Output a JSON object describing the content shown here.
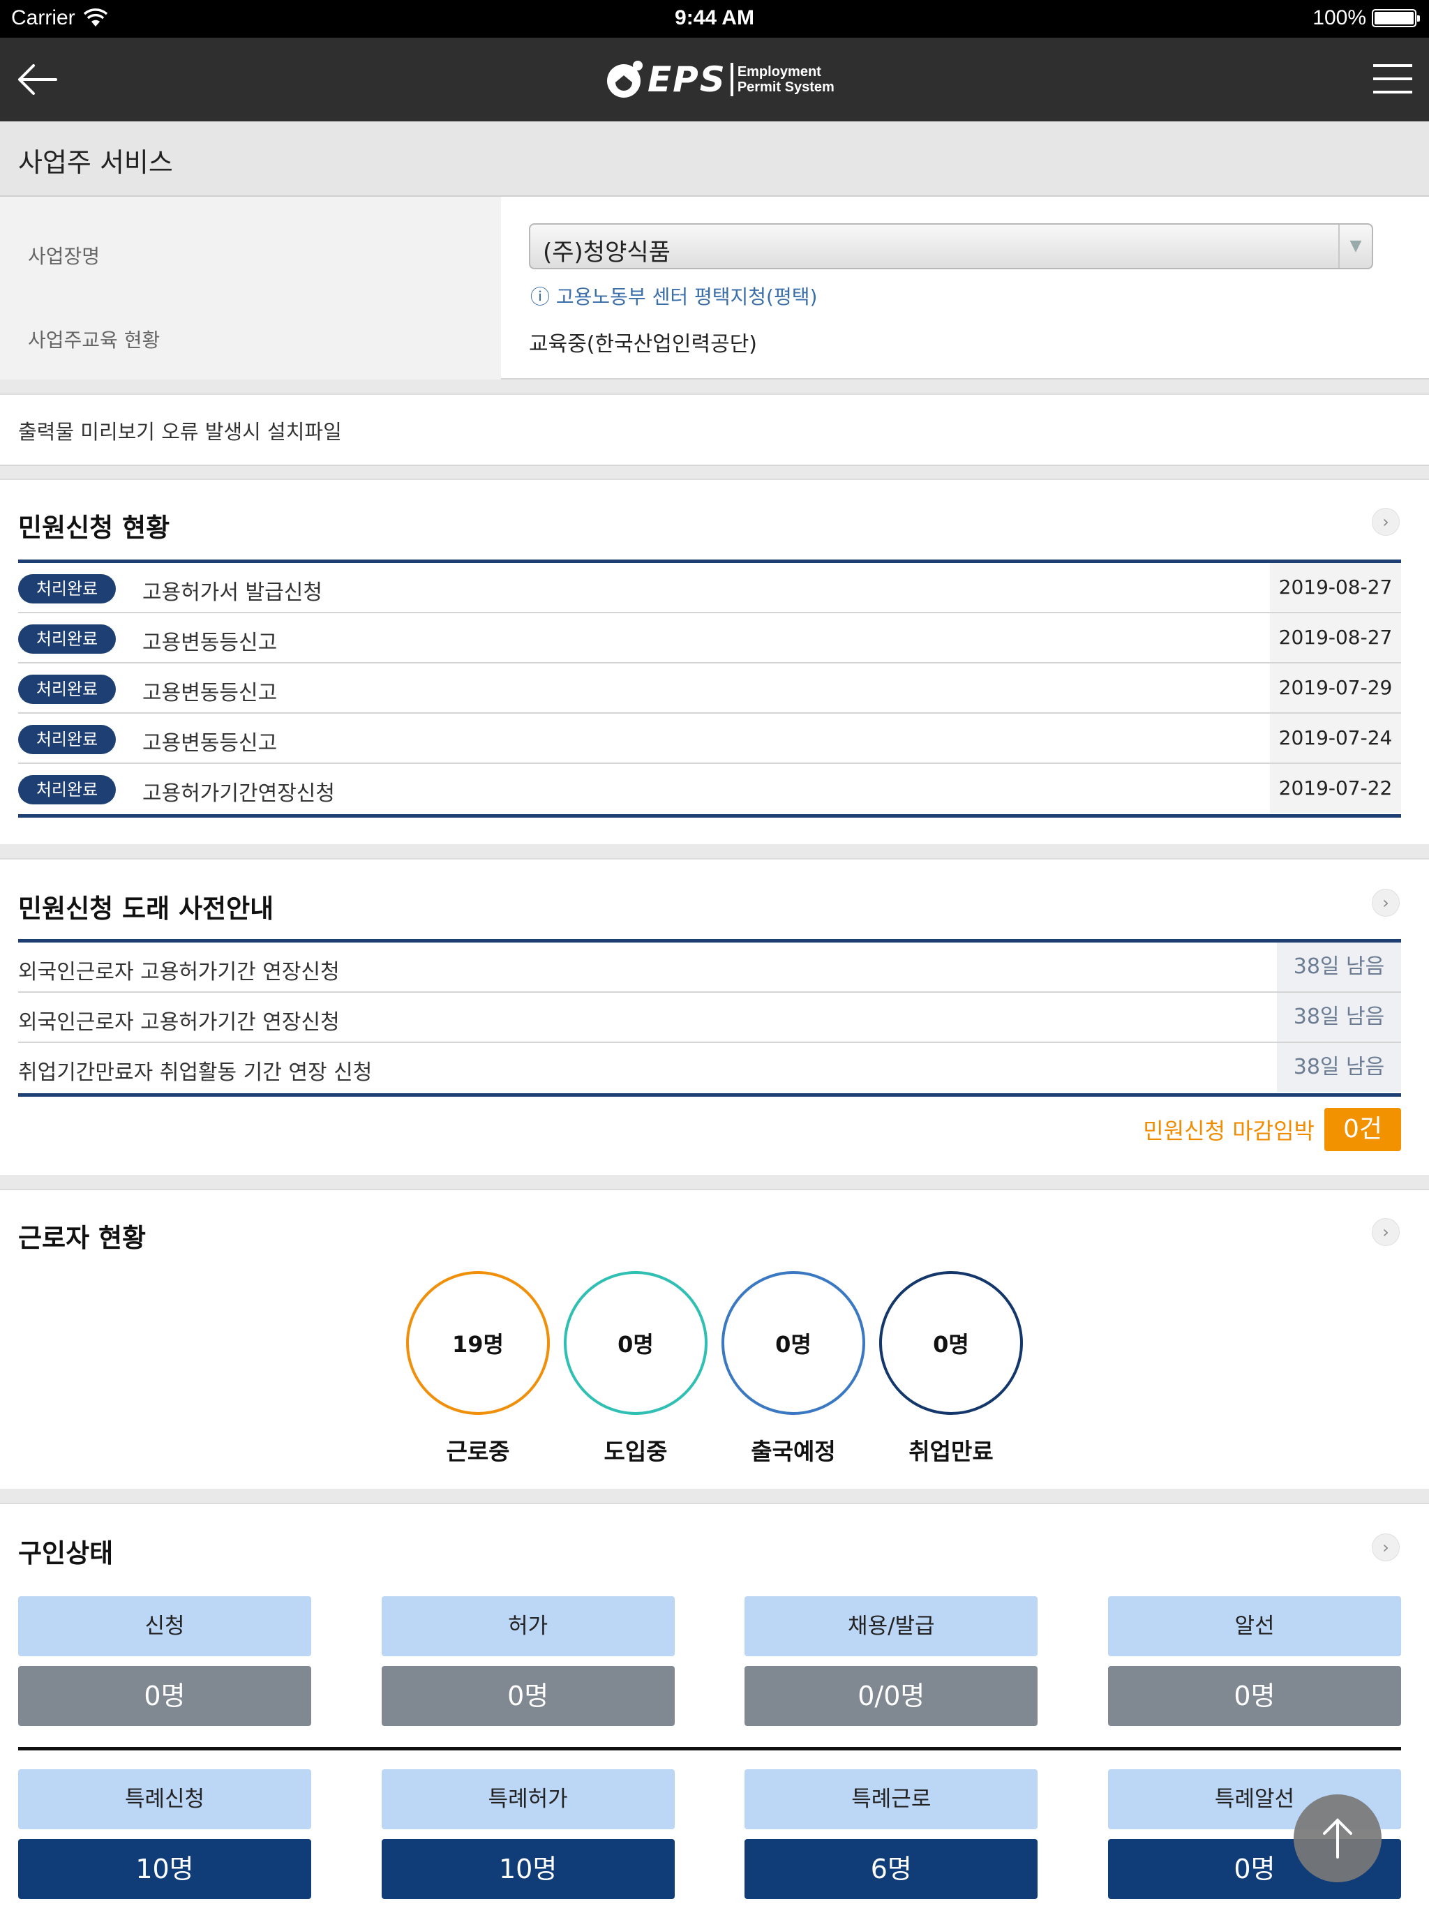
{
  "status_bar": {
    "carrier": "Carrier",
    "time": "9:44 AM",
    "battery": "100%"
  },
  "nav": {
    "logo_text": "EPS",
    "logo_sub_line1": "Employment",
    "logo_sub_line2": "Permit System"
  },
  "page_title": "사업주 서비스",
  "business": {
    "name_label": "사업장명",
    "name_value": "(주)청양식품",
    "center": "ⓘ 고용노동부 센터 평택지청(평택)",
    "edu_label": "사업주교육 현황",
    "edu_value": "교육중(한국산업인력공단)"
  },
  "install_link": "출력물 미리보기 오류 발생시 설치파일",
  "petition_status": {
    "title": "민원신청 현황",
    "items": [
      {
        "status": "처리완료",
        "title": "고용허가서 발급신청",
        "date": "2019-08-27"
      },
      {
        "status": "처리완료",
        "title": "고용변동등신고",
        "date": "2019-08-27"
      },
      {
        "status": "처리완료",
        "title": "고용변동등신고",
        "date": "2019-07-29"
      },
      {
        "status": "처리완료",
        "title": "고용변동등신고",
        "date": "2019-07-24"
      },
      {
        "status": "처리완료",
        "title": "고용허가기간연장신청",
        "date": "2019-07-22"
      }
    ]
  },
  "petition_notice": {
    "title": "민원신청 도래 사전안내",
    "items": [
      {
        "title": "외국인근로자 고용허가기간 연장신청",
        "days": "38일 남음"
      },
      {
        "title": "외국인근로자 고용허가기간 연장신청",
        "days": "38일 남음"
      },
      {
        "title": "취업기간만료자 취업활동 기간 연장 신청",
        "days": "38일 남음"
      }
    ],
    "deadline_label": "민원신청 마감임박",
    "deadline_count": "0건"
  },
  "worker_status": {
    "title": "근로자 현황",
    "items": [
      {
        "count": "19명",
        "label": "근로중",
        "color": "#f0900a"
      },
      {
        "count": "0명",
        "label": "도입중",
        "color": "#2fbfb3"
      },
      {
        "count": "0명",
        "label": "출국예정",
        "color": "#3a78c2"
      },
      {
        "count": "0명",
        "label": "취업만료",
        "color": "#13376b"
      }
    ]
  },
  "recruitment": {
    "title": "구인상태",
    "row1": [
      {
        "label": "신청",
        "value": "0명"
      },
      {
        "label": "허가",
        "value": "0명"
      },
      {
        "label": "채용/발급",
        "value": "0/0명"
      },
      {
        "label": "알선",
        "value": "0명"
      }
    ],
    "row2": [
      {
        "label": "특례신청",
        "value": "10명"
      },
      {
        "label": "특례허가",
        "value": "10명"
      },
      {
        "label": "특례근로",
        "value": "6명"
      },
      {
        "label": "특례알선",
        "value": "0명"
      }
    ]
  },
  "colors": {
    "nav_bg": "#2f2f2f",
    "navy": "#1d3f73",
    "orange": "#f39200",
    "light_blue": "#bcd6f5"
  },
  "icons": [
    "back-arrow-icon",
    "menu-icon",
    "chevron-right-icon",
    "scroll-top-icon",
    "wifi-icon",
    "battery-icon"
  ]
}
